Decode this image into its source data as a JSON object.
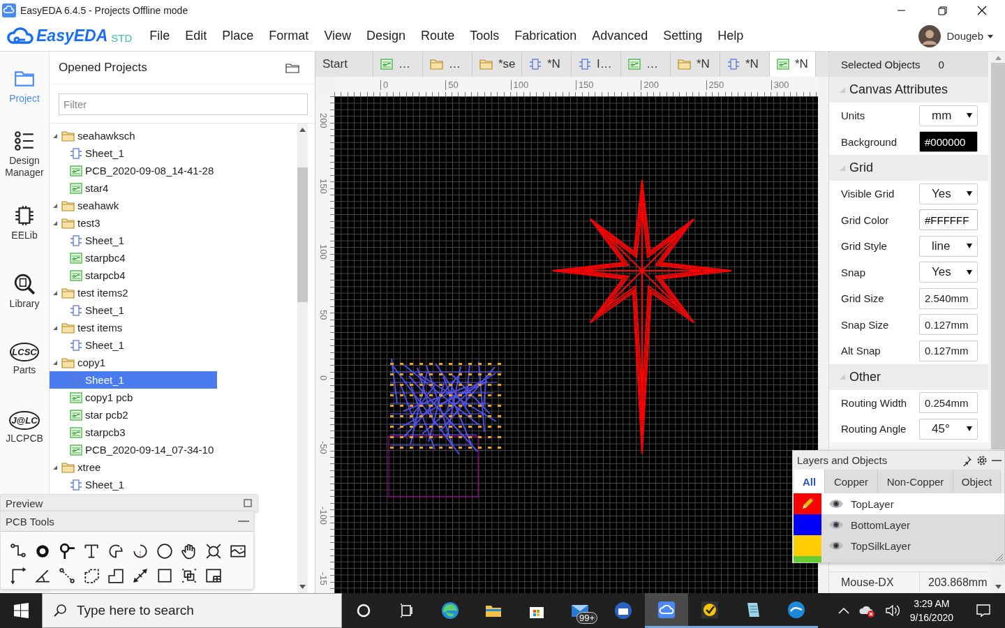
{
  "window": {
    "title": "EasyEDA 6.4.5 - Projects Offline mode"
  },
  "menu_bar": {
    "logo": "EasyEDA",
    "edition": "STD",
    "items": [
      "File",
      "Edit",
      "Place",
      "Format",
      "View",
      "Design",
      "Route",
      "Tools",
      "Fabrication",
      "Advanced",
      "Setting",
      "Help"
    ],
    "user": "Dougeb"
  },
  "nav": [
    {
      "kind": "project",
      "label": "Project",
      "selected": true
    },
    {
      "kind": "design-manager",
      "label": "Design Manager",
      "selected": false
    },
    {
      "kind": "eelib",
      "label": "EELib",
      "selected": false
    },
    {
      "kind": "library",
      "label": "Library",
      "selected": false
    },
    {
      "kind": "parts",
      "logo": "LCSC",
      "label": "Parts",
      "selected": false
    },
    {
      "kind": "jlcpcb",
      "logo": "J@LC",
      "label": "JLCPCB",
      "selected": false
    }
  ],
  "projects_panel": {
    "title": "Opened Projects",
    "filter": {
      "placeholder": "Filter"
    },
    "tree": [
      {
        "kind": "folder",
        "label": "seahawksch",
        "expanded": true,
        "selected": false,
        "children": [
          {
            "kind": "schematic",
            "label": "Sheet_1",
            "selected": false
          },
          {
            "kind": "pcb",
            "label": "PCB_2020-09-08_14-41-28",
            "selected": false
          },
          {
            "kind": "pcb",
            "label": "star4",
            "selected": false
          }
        ]
      },
      {
        "kind": "folder",
        "label": "seahawk",
        "expanded": true,
        "selected": false
      },
      {
        "kind": "folder",
        "label": "test3",
        "expanded": true,
        "selected": false,
        "children": [
          {
            "kind": "schematic",
            "label": "Sheet_1",
            "selected": false
          },
          {
            "kind": "pcb",
            "label": "starpbc4",
            "selected": false
          },
          {
            "kind": "pcb",
            "label": "starpcb4",
            "selected": false
          }
        ]
      },
      {
        "kind": "folder",
        "label": "test items2",
        "expanded": true,
        "selected": false,
        "children": [
          {
            "kind": "schematic",
            "label": "Sheet_1",
            "selected": false
          }
        ]
      },
      {
        "kind": "folder",
        "label": "test items",
        "expanded": true,
        "selected": false,
        "children": [
          {
            "kind": "schematic",
            "label": "Sheet_1",
            "selected": false
          }
        ]
      },
      {
        "kind": "folder",
        "label": "copy1",
        "expanded": true,
        "selected": false,
        "children": [
          {
            "kind": "schematic",
            "label": "Sheet_1",
            "selected": true
          },
          {
            "kind": "pcb",
            "label": "copy1 pcb",
            "selected": false
          },
          {
            "kind": "pcb",
            "label": "star pcb2",
            "selected": false
          },
          {
            "kind": "pcb",
            "label": "starpcb3",
            "selected": false
          },
          {
            "kind": "pcb",
            "label": "PCB_2020-09-14_07-34-10",
            "selected": false
          }
        ]
      },
      {
        "kind": "folder",
        "label": "xtree",
        "expanded": true,
        "selected": false,
        "children": [
          {
            "kind": "schematic",
            "label": "Sheet_1",
            "selected": false
          }
        ]
      }
    ]
  },
  "preview_panel": {
    "title": "Preview"
  },
  "pcb_tools": {
    "title": "PCB Tools"
  },
  "tabs": [
    {
      "kind": "start",
      "label": "Start",
      "selected": false
    },
    {
      "kind": "pcb",
      "label": "…",
      "selected": false
    },
    {
      "kind": "folder",
      "label": "…",
      "selected": false
    },
    {
      "kind": "folder",
      "label": "*se",
      "selected": false
    },
    {
      "kind": "schematic",
      "label": "*N",
      "selected": false
    },
    {
      "kind": "schematic",
      "label": "I…",
      "selected": false
    },
    {
      "kind": "pcb",
      "label": "…",
      "selected": false
    },
    {
      "kind": "folder",
      "label": "*N",
      "selected": false
    },
    {
      "kind": "schematic",
      "label": "*N",
      "selected": false
    },
    {
      "kind": "pcb",
      "label": "*N",
      "selected": true
    }
  ],
  "rulers": {
    "horizontal": [
      "0",
      "50",
      "100",
      "150",
      "200",
      "250",
      "300"
    ],
    "vertical": [
      "200",
      "150",
      "100",
      "50",
      "0",
      "-50",
      "-100",
      "-15"
    ]
  },
  "properties": {
    "selected_objects": {
      "label": "Selected Objects",
      "value": "0"
    },
    "sections": [
      {
        "title": "Canvas Attributes",
        "expanded": true,
        "rows": [
          {
            "label": "Units",
            "kind": "select",
            "value": "mm"
          },
          {
            "label": "Background",
            "kind": "color",
            "value": "#000000"
          }
        ]
      },
      {
        "title": "Grid",
        "expanded": true,
        "rows": [
          {
            "label": "Visible Grid",
            "kind": "select",
            "value": "Yes"
          },
          {
            "label": "Grid Color",
            "kind": "color",
            "value": "#FFFFFF"
          },
          {
            "label": "Grid Style",
            "kind": "select",
            "value": "line"
          },
          {
            "label": "Snap",
            "kind": "select",
            "value": "Yes"
          },
          {
            "label": "Grid Size",
            "kind": "text",
            "value": "2.540mm"
          },
          {
            "label": "Snap Size",
            "kind": "text",
            "value": "0.127mm"
          },
          {
            "label": "Alt Snap",
            "kind": "text",
            "value": "0.127mm"
          }
        ]
      },
      {
        "title": "Other",
        "expanded": true,
        "rows": [
          {
            "label": "Routing Width",
            "kind": "text",
            "value": "0.254mm"
          },
          {
            "label": "Routing Angle",
            "kind": "select",
            "value": "45°"
          }
        ]
      }
    ],
    "readout": [
      {
        "label": "Mouse-DX",
        "value": "203.868mm"
      }
    ]
  },
  "layers_panel": {
    "title": "Layers and Objects",
    "tabs": [
      {
        "label": "All",
        "selected": true
      },
      {
        "label": "Copper",
        "selected": false
      },
      {
        "label": "Non-Copper",
        "selected": false
      },
      {
        "label": "Object",
        "selected": false
      }
    ],
    "layers": [
      {
        "name": "TopLayer",
        "color": "#ff0000",
        "active": true
      },
      {
        "name": "BottomLayer",
        "color": "#0000ff",
        "active": false
      },
      {
        "name": "TopSilkLayer",
        "color": "#ffcc00",
        "active": false
      },
      {
        "color": "#66cc33",
        "active": false
      }
    ]
  },
  "taskbar": {
    "search": {
      "placeholder": "Type here to search"
    },
    "apps": [
      {
        "kind": "cortana",
        "active": false,
        "running": false
      },
      {
        "kind": "task-view",
        "active": false,
        "running": false
      },
      {
        "kind": "edge",
        "active": false,
        "running": false
      },
      {
        "kind": "explorer",
        "active": false,
        "running": false
      },
      {
        "kind": "store",
        "active": false,
        "running": false
      },
      {
        "kind": "mail",
        "badge": "99+",
        "active": false,
        "running": false
      },
      {
        "kind": "thunderbird",
        "active": false,
        "running": false
      },
      {
        "kind": "easyeda",
        "active": true,
        "running": true
      },
      {
        "kind": "norton",
        "active": false,
        "running": true
      },
      {
        "kind": "notepad",
        "active": false,
        "running": true
      },
      {
        "kind": "openoffice",
        "active": false,
        "running": true
      }
    ],
    "clock": {
      "time": "3:29 AM",
      "date": "9/16/2020"
    }
  }
}
